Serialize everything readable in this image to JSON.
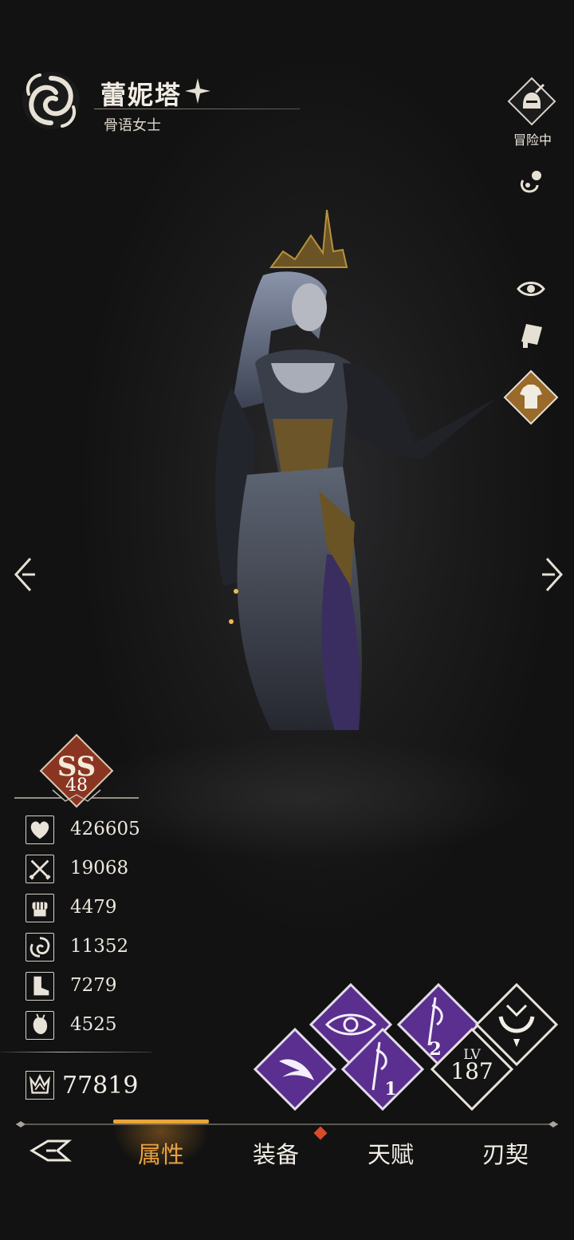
{
  "character": {
    "name": "蕾妮塔",
    "title": "骨语女士",
    "status": "冒险中"
  },
  "rank": {
    "grade": "SS",
    "level": "48"
  },
  "stats": [
    {
      "icon": "heart-icon",
      "value": "426605"
    },
    {
      "icon": "crossed-swords-icon",
      "value": "19068"
    },
    {
      "icon": "fist-icon",
      "value": "4479"
    },
    {
      "icon": "vortex-icon",
      "value": "11352"
    },
    {
      "icon": "boot-icon",
      "value": "7279"
    },
    {
      "icon": "anatomical-heart-icon",
      "value": "4525"
    }
  ],
  "power": {
    "icon": "crown-emblem-icon",
    "value": "77819"
  },
  "skills": {
    "level_label": "LV",
    "level": "187",
    "slot_1": "1",
    "slot_2": "2"
  },
  "nav": {
    "tabs": [
      {
        "label": "属性",
        "active": true
      },
      {
        "label": "装备",
        "active": false,
        "badge": true
      },
      {
        "label": "天赋",
        "active": false
      },
      {
        "label": "刃契",
        "active": false
      }
    ]
  },
  "colors": {
    "accent": "#e9a23c",
    "skill_purple": "#5a2f8f",
    "rank_red": "#8a3522",
    "badge_red": "#d94a2a"
  }
}
